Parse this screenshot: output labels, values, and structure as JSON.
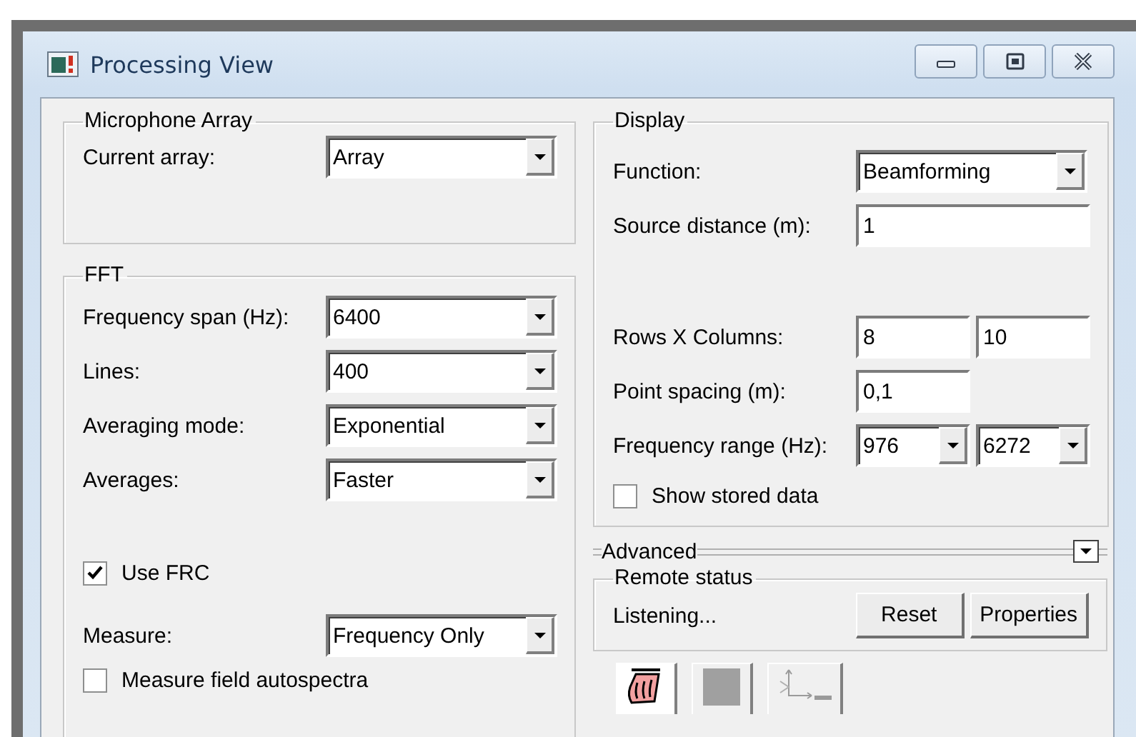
{
  "window": {
    "title": "Processing View",
    "controls": [
      {
        "kind": "minimize"
      },
      {
        "kind": "maximize"
      },
      {
        "kind": "close"
      }
    ]
  },
  "microphone_array": {
    "title": "Microphone Array",
    "fields": [
      {
        "kind": "dropdown",
        "label": "Current array:",
        "value": "Array"
      }
    ]
  },
  "fft": {
    "title": "FFT",
    "fields": [
      {
        "kind": "dropdown",
        "label": "Frequency span (Hz):",
        "value": "6400"
      },
      {
        "kind": "dropdown",
        "label": "Lines:",
        "value": "400"
      },
      {
        "kind": "dropdown",
        "label": "Averaging mode:",
        "value": "Exponential"
      },
      {
        "kind": "dropdown",
        "label": "Averages:",
        "value": "Faster"
      },
      {
        "kind": "checkbox",
        "label": "Use FRC",
        "checked": true
      },
      {
        "kind": "dropdown",
        "label": "Measure:",
        "value": "Frequency Only"
      },
      {
        "kind": "checkbox",
        "label": "Measure field autospectra",
        "checked": false
      }
    ]
  },
  "display": {
    "title": "Display",
    "fields": [
      {
        "kind": "dropdown",
        "label": "Function:",
        "value": "Beamforming"
      },
      {
        "kind": "text",
        "label": "Source distance (m):",
        "value": "1"
      },
      {
        "kind": "text-pair",
        "label": "Rows X Columns:",
        "values": [
          "8",
          "10"
        ]
      },
      {
        "kind": "text",
        "label": "Point spacing (m):",
        "value": "0,1"
      },
      {
        "kind": "dropdown-pair",
        "label": "Frequency range (Hz):",
        "values": [
          "976",
          "6272"
        ]
      },
      {
        "kind": "checkbox",
        "label": "Show stored data",
        "checked": false
      }
    ]
  },
  "advanced": {
    "label": "Advanced",
    "expanded": false
  },
  "remote_status": {
    "title": "Remote status",
    "status": "Listening...",
    "buttons": [
      "Reset",
      "Properties"
    ]
  },
  "toolbar": [
    {
      "kind": "hand"
    },
    {
      "kind": "swatch"
    },
    {
      "kind": "axes"
    }
  ]
}
